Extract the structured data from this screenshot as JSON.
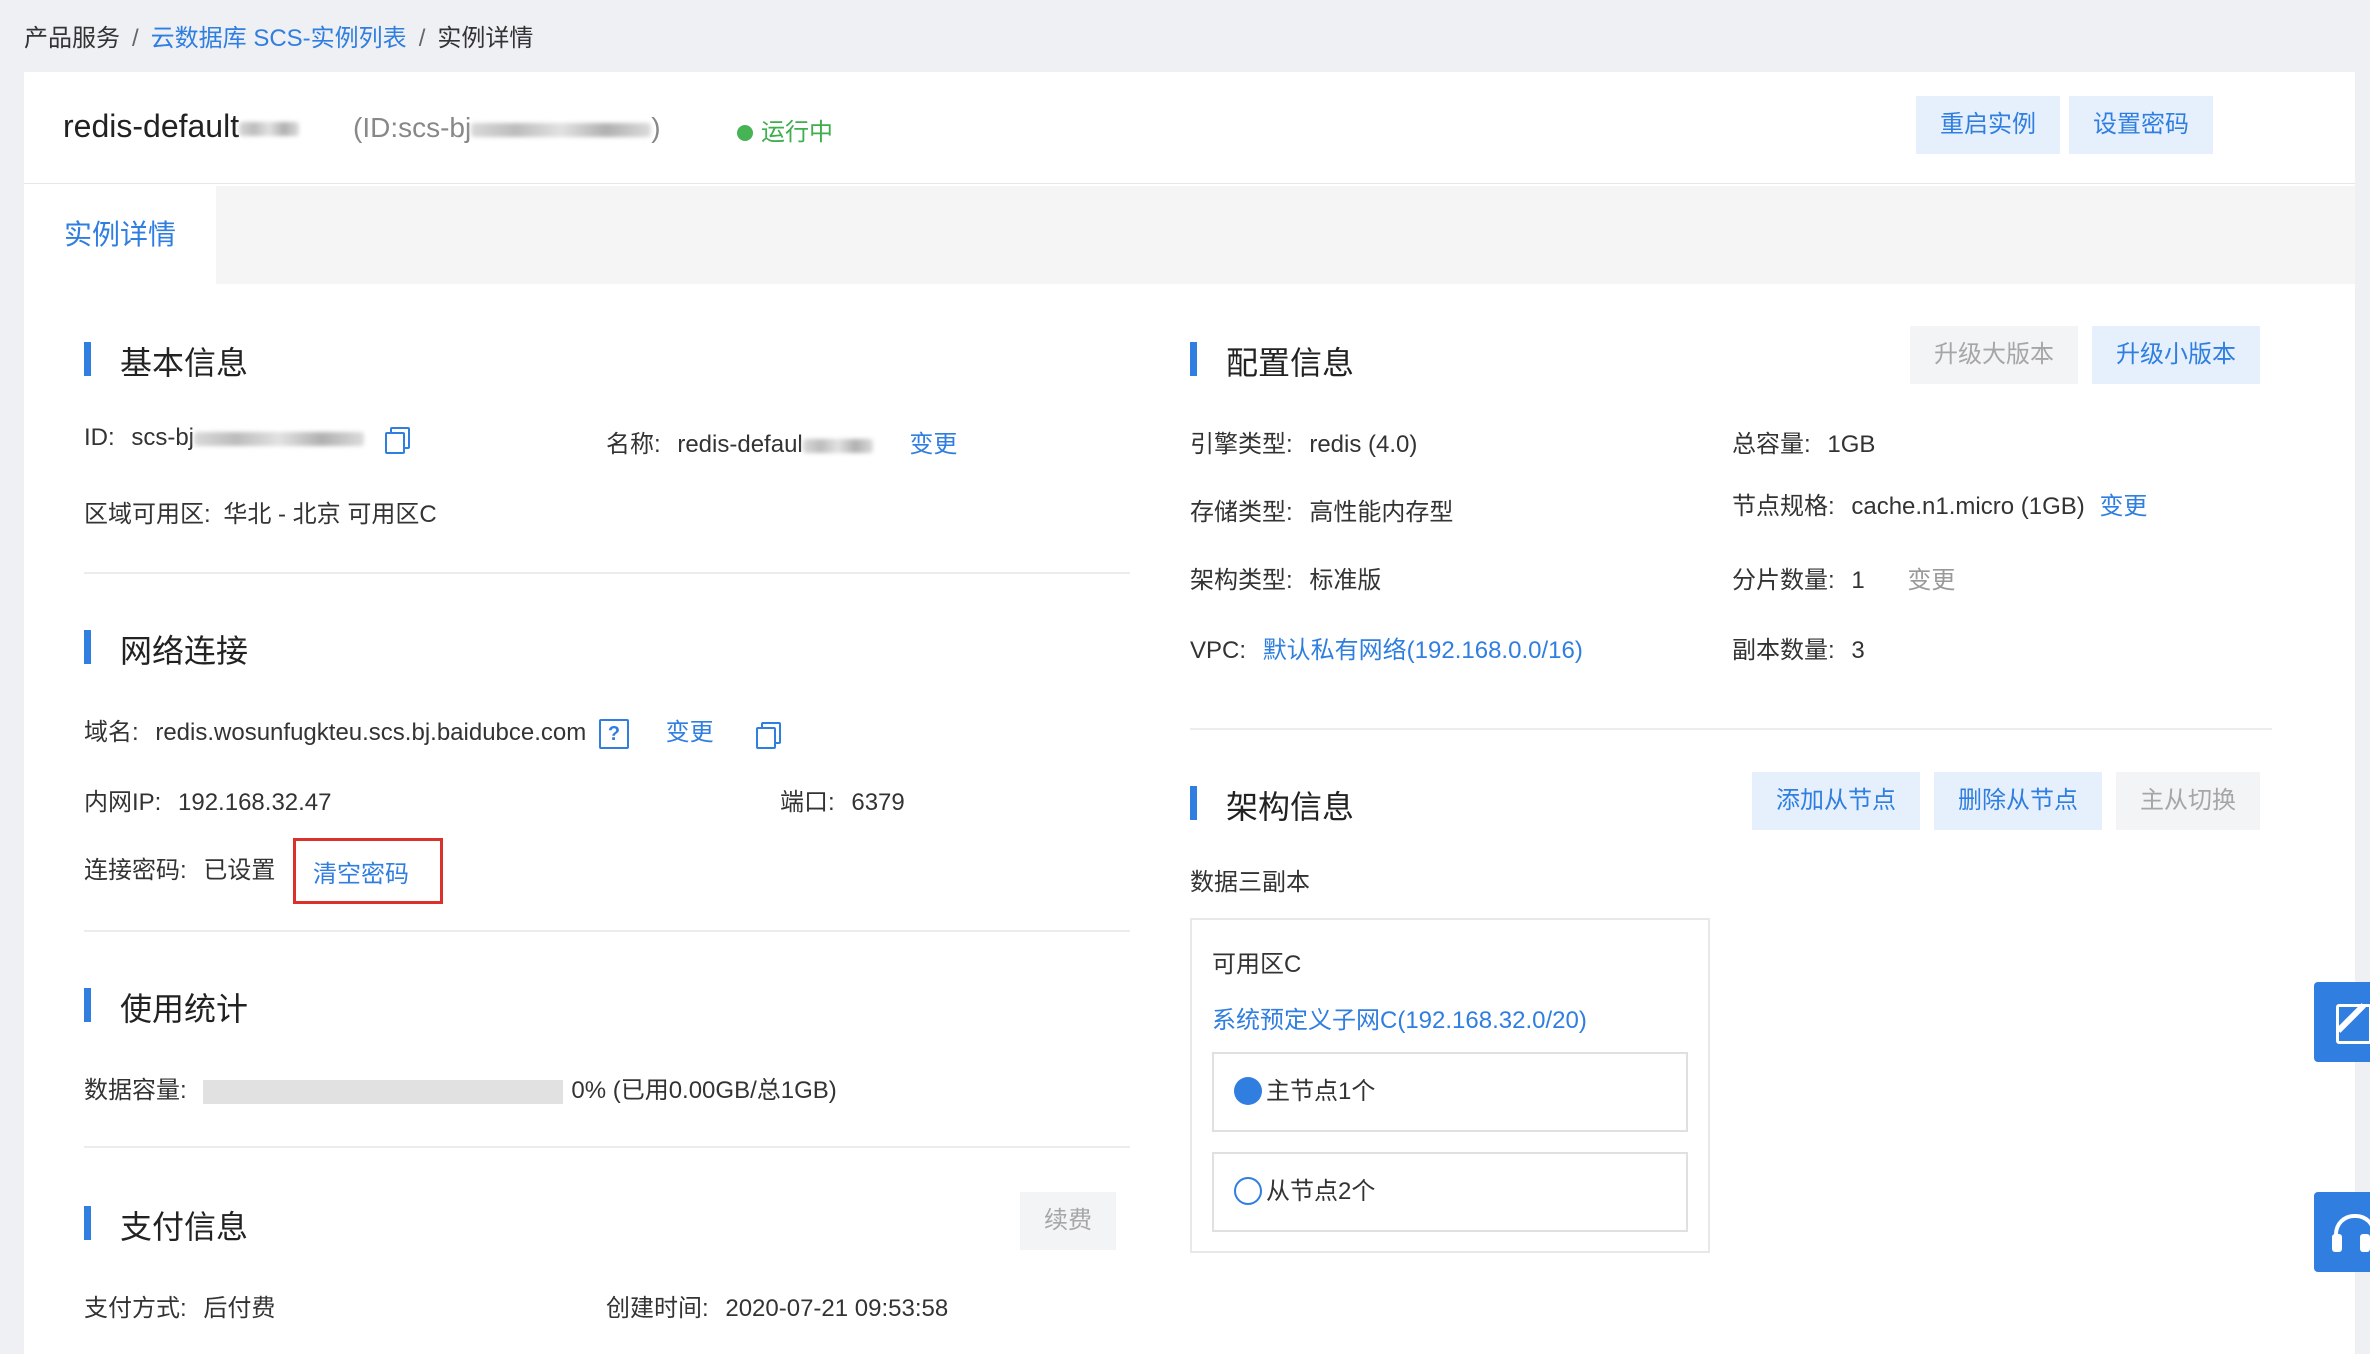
{
  "breadcrumb": {
    "root": "产品服务",
    "list": "云数据库 SCS-实例列表",
    "current": "实例详情",
    "sep": "/"
  },
  "header": {
    "name": "redis-default",
    "id_prefix": "(ID:scs-bj",
    "id_suffix": ")",
    "status": "运行中",
    "restart_label": "重启实例",
    "set_password_label": "设置密码"
  },
  "tabs": [
    {
      "label": "实例详情"
    }
  ],
  "basic": {
    "title": "基本信息",
    "id_label": "ID:",
    "id_value": "scs-bj",
    "name_label": "名称:",
    "name_value": "redis-defaul",
    "change_label": "变更",
    "region_label": "区域可用区:",
    "region_value": "华北 - 北京 可用区C"
  },
  "network": {
    "title": "网络连接",
    "domain_label": "域名:",
    "domain_value": "redis.wosunfugkteu.scs.bj.baidubce.com",
    "help_glyph": "?",
    "change_label": "变更",
    "ip_label": "内网IP:",
    "ip_value": "192.168.32.47",
    "port_label": "端口:",
    "port_value": "6379",
    "password_label": "连接密码:",
    "password_value": "已设置",
    "clear_password_label": "清空密码"
  },
  "usage": {
    "title": "使用统计",
    "capacity_label": "数据容量:",
    "capacity_text": "0% (已用0.00GB/总1GB)",
    "percent": 0
  },
  "payment": {
    "title": "支付信息",
    "renew_label": "续费",
    "method_label": "支付方式:",
    "method_value": "后付费",
    "created_label": "创建时间:",
    "created_value": "2020-07-21 09:53:58"
  },
  "config": {
    "title": "配置信息",
    "upgrade_major_label": "升级大版本",
    "upgrade_minor_label": "升级小版本",
    "engine_label": "引擎类型:",
    "engine_value": "redis (4.0)",
    "capacity_label": "总容量:",
    "capacity_value": "1GB",
    "storage_label": "存储类型:",
    "storage_value": "高性能内存型",
    "spec_label": "节点规格:",
    "spec_value": "cache.n1.micro (1GB)",
    "spec_change": "变更",
    "arch_label": "架构类型:",
    "arch_value": "标准版",
    "shard_label": "分片数量:",
    "shard_value": "1",
    "shard_change": "变更",
    "vpc_label": "VPC:",
    "vpc_value": "默认私有网络(192.168.0.0/16)",
    "replica_label": "副本数量:",
    "replica_value": "3"
  },
  "architecture": {
    "title": "架构信息",
    "add_slave_label": "添加从节点",
    "delete_slave_label": "删除从节点",
    "switch_label": "主从切换",
    "mode": "数据三副本",
    "zone_name": "可用区C",
    "subnet": "系统预定义子网C(192.168.32.0/20)",
    "master_label": "主节点1个",
    "slave_label": "从节点2个"
  },
  "colors": {
    "accent": "#2f7ee0",
    "status_green": "#46b354",
    "highlight_red": "#d9312b"
  }
}
